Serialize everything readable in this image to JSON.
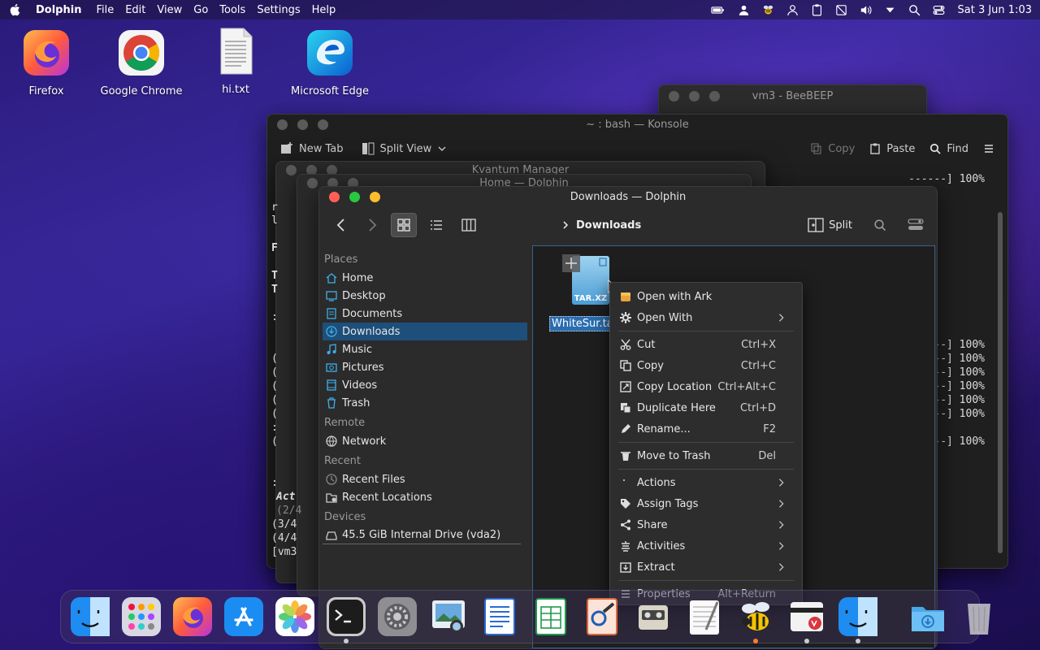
{
  "menubar": {
    "app": "Dolphin",
    "menus": [
      "File",
      "Edit",
      "View",
      "Go",
      "Tools",
      "Settings",
      "Help"
    ],
    "clock": "Sat 3 Jun 1:03"
  },
  "desktop": {
    "icons": [
      {
        "label": "Firefox"
      },
      {
        "label": "Google Chrome"
      },
      {
        "label": "hi.txt"
      },
      {
        "label": "Microsoft Edge"
      }
    ]
  },
  "beebeep": {
    "title": "vm3 - BeeBEEP"
  },
  "konsole": {
    "title": "~ : bash — Konsole",
    "new_tab": "New Tab",
    "split_view": "Split View",
    "copy": "Copy",
    "paste": "Paste",
    "find": "Find",
    "lines_top": [
      "------] 100%"
    ],
    "lines_mid": [
      "--] 100%",
      "--] 100%",
      "--] 100%",
      "--] 100%",
      "--] 100%",
      "--] 100%"
    ],
    "line_bottom": "--] 100%"
  },
  "kvantum": {
    "title": "Kvantum Manager"
  },
  "home_dolphin": {
    "title": "Home — Dolphin"
  },
  "sliver": {
    "lines": [
      "r",
      "l",
      "F",
      "T",
      "T",
      ":",
      "(",
      "(",
      "(",
      "(",
      "(",
      ":",
      "(",
      ":",
      "Act",
      "(2/4",
      "(3/4",
      "(4/4",
      "[vm3"
    ]
  },
  "dolphin": {
    "title": "Downloads — Dolphin",
    "breadcrumb": "Downloads",
    "split_label": "Split",
    "places_header": "Places",
    "places": [
      "Home",
      "Desktop",
      "Documents",
      "Downloads",
      "Music",
      "Pictures",
      "Videos",
      "Trash"
    ],
    "selected_place": "Downloads",
    "remote_header": "Remote",
    "remote": [
      "Network"
    ],
    "recent_header": "Recent",
    "recent": [
      "Recent Files",
      "Recent Locations"
    ],
    "devices_header": "Devices",
    "devices": [
      "45.5 GiB Internal Drive (vda2)"
    ],
    "file": {
      "name": "WhiteSur.tar",
      "badge": "TAR.XZ"
    }
  },
  "context_menu": {
    "items": [
      {
        "label": "Open with Ark",
        "shortcut": "",
        "submenu": false,
        "icon": "ark-icon"
      },
      {
        "label": "Open With",
        "shortcut": "",
        "submenu": true,
        "icon": "gear-icon"
      },
      {
        "label": "Cut",
        "shortcut": "Ctrl+X",
        "submenu": false,
        "icon": "scissors-icon"
      },
      {
        "label": "Copy",
        "shortcut": "Ctrl+C",
        "submenu": false,
        "icon": "copy-icon"
      },
      {
        "label": "Copy Location",
        "shortcut": "Ctrl+Alt+C",
        "submenu": false,
        "icon": "copy-location-icon"
      },
      {
        "label": "Duplicate Here",
        "shortcut": "Ctrl+D",
        "submenu": false,
        "icon": "duplicate-icon"
      },
      {
        "label": "Rename...",
        "shortcut": "F2",
        "submenu": false,
        "icon": "pencil-icon"
      },
      {
        "label": "Move to Trash",
        "shortcut": "Del",
        "submenu": false,
        "icon": "trash-icon"
      },
      {
        "label": "Actions",
        "shortcut": "",
        "submenu": true,
        "icon": "actions-icon"
      },
      {
        "label": "Assign Tags",
        "shortcut": "",
        "submenu": true,
        "icon": "tag-icon"
      },
      {
        "label": "Share",
        "shortcut": "",
        "submenu": true,
        "icon": "share-icon"
      },
      {
        "label": "Activities",
        "shortcut": "",
        "submenu": true,
        "icon": "activities-icon"
      },
      {
        "label": "Extract",
        "shortcut": "",
        "submenu": true,
        "icon": "extract-icon"
      },
      {
        "label": "Properties",
        "shortcut": "Alt+Return",
        "submenu": false,
        "icon": "properties-icon"
      }
    ]
  },
  "dock": {
    "apps": [
      "finder",
      "launchpad",
      "firefox",
      "app-store",
      "photos",
      "terminal",
      "system-settings",
      "preview",
      "writer",
      "calc",
      "draw",
      "recorder",
      "textedit",
      "beebeep",
      "kvantum",
      "finder-2",
      "downloads",
      "trash"
    ]
  }
}
